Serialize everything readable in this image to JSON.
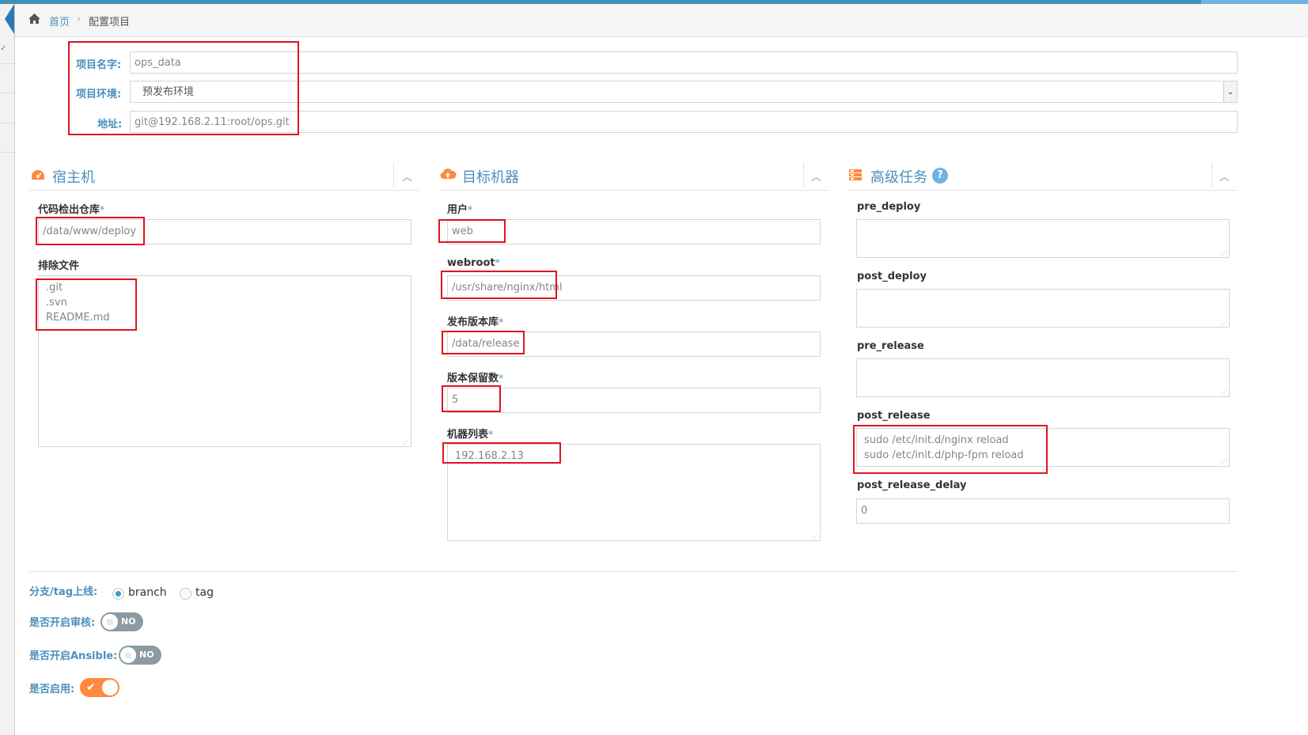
{
  "breadcrumb": {
    "home": "首页",
    "separator": "›",
    "current": "配置项目"
  },
  "project": {
    "name_label": "项目名字:",
    "name_value": "ops_data",
    "env_label": "项目环境:",
    "env_value": "预发布环境",
    "addr_label": "地址:",
    "addr_value": "git@192.168.2.11:root/ops.git"
  },
  "host_box": {
    "title": "宿主机",
    "repo_label": "代码检出仓库",
    "repo_value": "/data/www/deploy",
    "exclude_label": "排除文件",
    "exclude_lines": [
      ".git",
      ".svn",
      "README.md"
    ]
  },
  "target_box": {
    "title": "目标机器",
    "user_label": "用户",
    "user_value": "web",
    "webroot_label": "webroot",
    "webroot_value": "/usr/share/nginx/html",
    "release_label": "发布版本库",
    "release_value": "/data/release",
    "keep_label": "版本保留数",
    "keep_value": "5",
    "hosts_label": "机器列表",
    "hosts_value": "192.168.2.13"
  },
  "task_box": {
    "title": "高级任务",
    "help": "?",
    "pre_deploy_label": "pre_deploy",
    "post_deploy_label": "post_deploy",
    "pre_release_label": "pre_release",
    "post_release_label": "post_release",
    "post_release_lines": [
      "sudo /etc/init.d/nginx reload",
      "sudo /etc/init.d/php-fpm reload"
    ],
    "post_release_delay_label": "post_release_delay",
    "post_release_delay_value": "0"
  },
  "options": {
    "branch_label": "分支/tag上线:",
    "branch_option": "branch",
    "tag_option": "tag",
    "selected": "branch",
    "audit_label": "是否开启审核:",
    "audit_state": "NO",
    "ansible_label": "是否开启Ansible:",
    "ansible_state": "NO",
    "enable_label": "是否启用:",
    "enable_state": "on"
  },
  "required_mark": "*",
  "colors": {
    "accent": "#4c8fbd",
    "highlight_box": "#e0141e",
    "toggle_on": "#ff893c",
    "toggle_off": "#8b9aa3"
  }
}
